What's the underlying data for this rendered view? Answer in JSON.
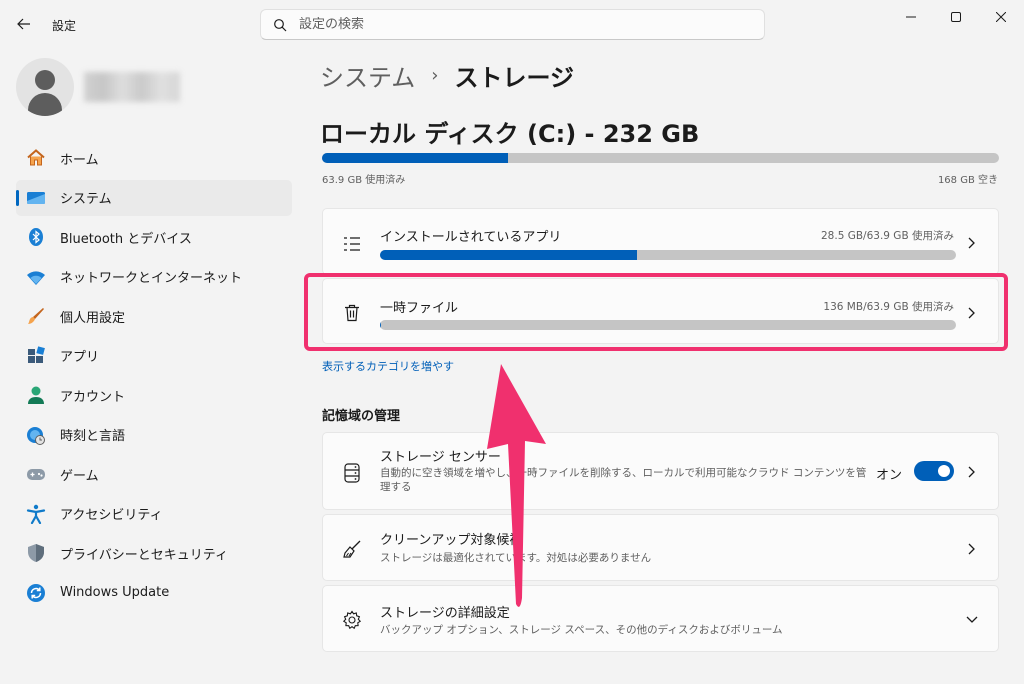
{
  "window": {
    "title": "設定"
  },
  "search": {
    "placeholder": "設定の検索"
  },
  "sidebar": {
    "items": [
      {
        "label": "ホーム",
        "icon": "home-icon"
      },
      {
        "label": "システム",
        "icon": "system-icon",
        "active": true
      },
      {
        "label": "Bluetooth とデバイス",
        "icon": "bluetooth-icon"
      },
      {
        "label": "ネットワークとインターネット",
        "icon": "wifi-icon"
      },
      {
        "label": "個人用設定",
        "icon": "brush-icon"
      },
      {
        "label": "アプリ",
        "icon": "apps-icon"
      },
      {
        "label": "アカウント",
        "icon": "account-icon"
      },
      {
        "label": "時刻と言語",
        "icon": "time-language-icon"
      },
      {
        "label": "ゲーム",
        "icon": "gamepad-icon"
      },
      {
        "label": "アクセシビリティ",
        "icon": "accessibility-icon"
      },
      {
        "label": "プライバシーとセキュリティ",
        "icon": "shield-icon"
      },
      {
        "label": "Windows Update",
        "icon": "windows-update-icon"
      }
    ]
  },
  "breadcrumb": {
    "parent": "システム",
    "separator": "›",
    "current": "ストレージ"
  },
  "disk": {
    "title": "ローカル ディスク (C:) - 232 GB",
    "used_label": "63.9 GB 使用済み",
    "free_label": "168 GB 空き",
    "used_fraction": 0.275
  },
  "categories": [
    {
      "title": "インストールされているアプリ",
      "usage": "28.5 GB/63.9 GB 使用済み",
      "fraction": 0.446,
      "icon": "list-icon"
    },
    {
      "title": "一時ファイル",
      "usage": "136 MB/63.9 GB 使用済み",
      "fraction": 0.002,
      "icon": "trash-icon"
    }
  ],
  "more_categories_link": "表示するカテゴリを増やす",
  "storage_management": {
    "heading": "記憶域の管理",
    "sense": {
      "title": "ストレージ センサー",
      "description": "自動的に空き領域を増やし、一時ファイルを削除する、ローカルで利用可能なクラウド コンテンツを管理する",
      "toggle_label": "オン",
      "toggle_on": true
    },
    "cleanup": {
      "title": "クリーンアップ対象候補",
      "description": "ストレージは最適化されています。対処は必要ありません"
    },
    "advanced": {
      "title": "ストレージの詳細設定",
      "description": "バックアップ オプション、ストレージ スペース、その他のディスクおよびボリューム"
    }
  },
  "colors": {
    "accent": "#005fb8",
    "annotation": "#f0306e",
    "bar_track": "#c5c5c5"
  }
}
